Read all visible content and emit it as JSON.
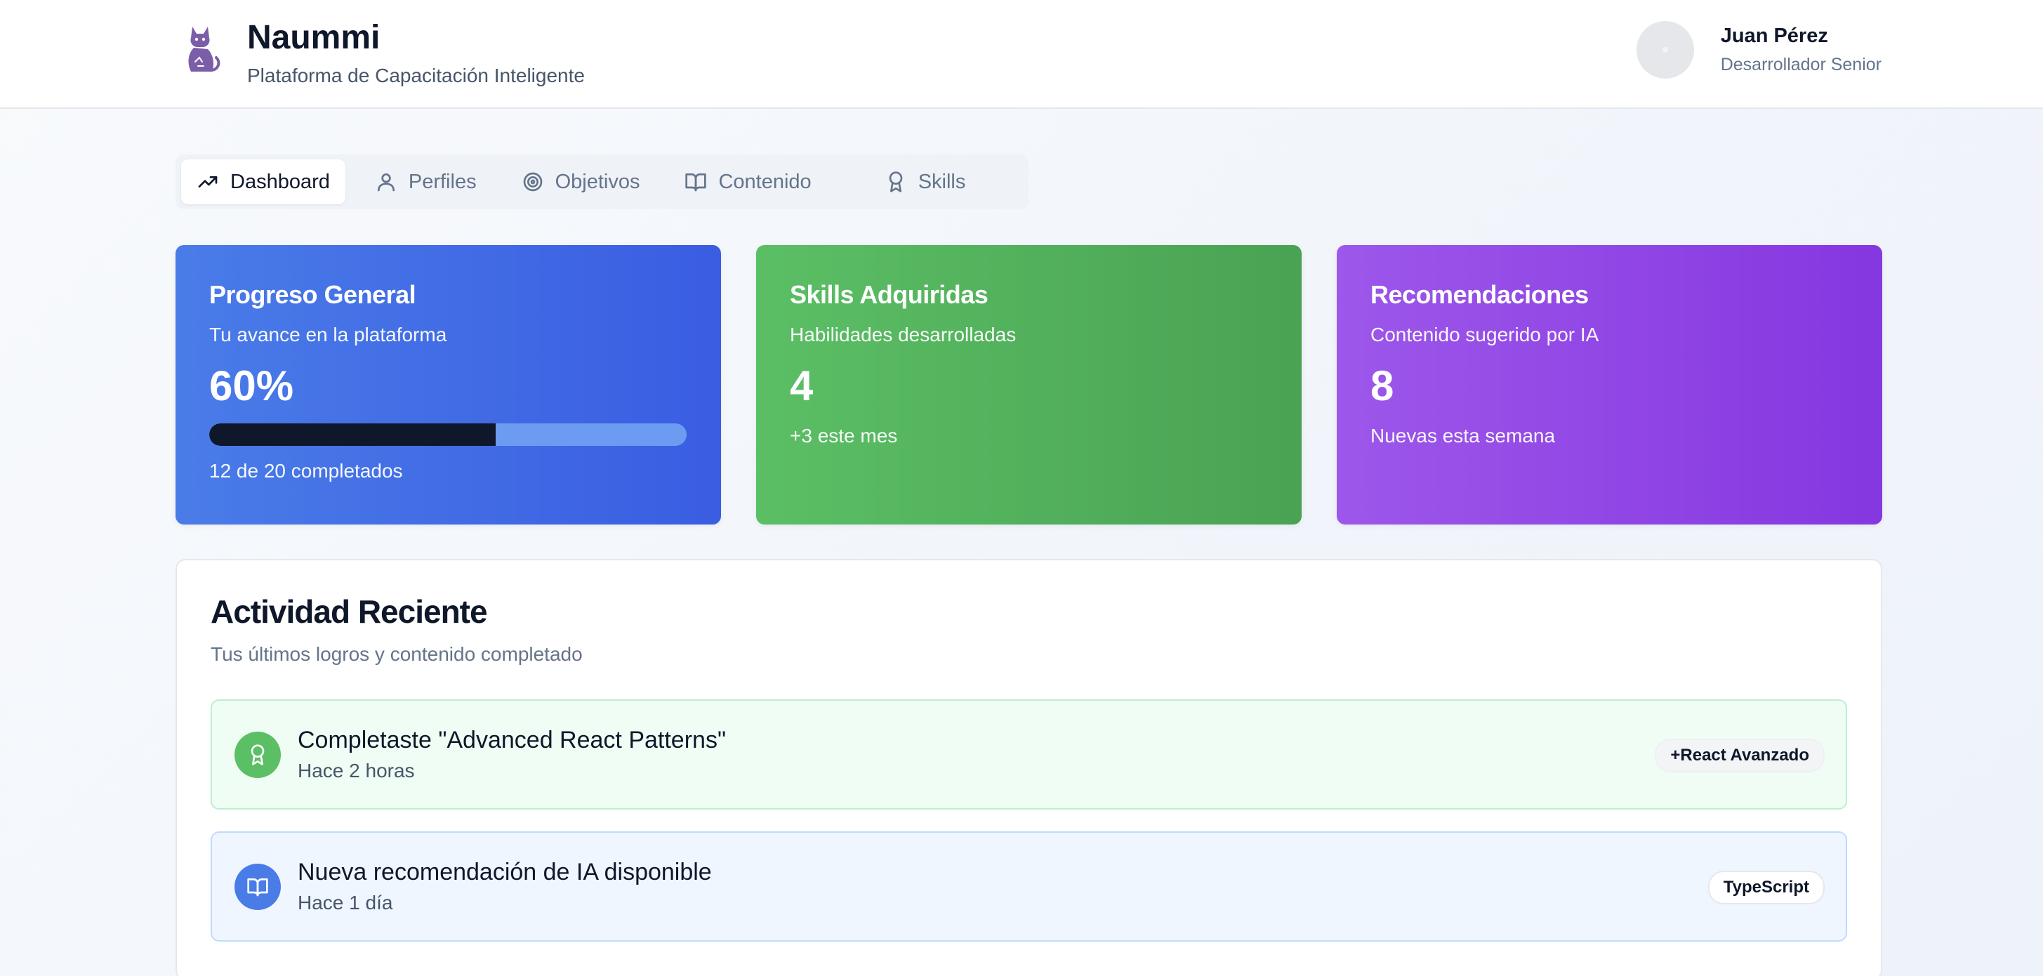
{
  "header": {
    "brand_name": "Naummi",
    "brand_subtitle": "Plataforma de Capacitación Inteligente",
    "user_name": "Juan Pérez",
    "user_role": "Desarrollador Senior"
  },
  "tabs": [
    {
      "label": "Dashboard",
      "icon": "trending-up-icon",
      "active": true
    },
    {
      "label": "Perfiles",
      "icon": "user-icon",
      "active": false
    },
    {
      "label": "Objetivos",
      "icon": "target-icon",
      "active": false
    },
    {
      "label": "Contenido",
      "icon": "book-open-icon",
      "active": false
    },
    {
      "label": "Skills",
      "icon": "award-icon",
      "active": false
    }
  ],
  "cards": {
    "progress": {
      "title": "Progreso General",
      "description": "Tu avance en la plataforma",
      "value": "60%",
      "progress_fraction": 0.6,
      "note": "12 de 20 completados"
    },
    "skills": {
      "title": "Skills Adquiridas",
      "description": "Habilidades desarrolladas",
      "value": "4",
      "note": "+3 este mes"
    },
    "recommendations": {
      "title": "Recomendaciones",
      "description": "Contenido sugerido por IA",
      "value": "8",
      "note": "Nuevas esta semana"
    }
  },
  "activity": {
    "title": "Actividad Reciente",
    "subtitle": "Tus últimos logros y contenido completado",
    "items": [
      {
        "title": "Completaste \"Advanced React Patterns\"",
        "time": "Hace 2 horas",
        "badge": "+React Avanzado",
        "icon": "award-icon"
      },
      {
        "title": "Nueva recomendación de IA disponible",
        "time": "Hace 1 día",
        "badge": "TypeScript",
        "icon": "book-open-icon"
      }
    ]
  },
  "colors": {
    "blue": "#4a7ce8",
    "green": "#5bbf65",
    "purple": "#9d57ea",
    "logo_purple": "#7b5ea7"
  }
}
